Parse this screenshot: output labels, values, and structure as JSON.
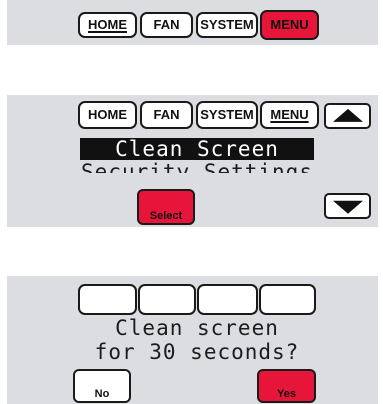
{
  "panel_1": {
    "tabs": [
      {
        "label": "HOME"
      },
      {
        "label": "FAN"
      },
      {
        "label": "SYSTEM"
      },
      {
        "label": "MENU"
      }
    ]
  },
  "panel_2": {
    "tabs": [
      {
        "label": "HOME"
      },
      {
        "label": "FAN"
      },
      {
        "label": "SYSTEM"
      },
      {
        "label": "MENU"
      }
    ],
    "selected_item": "Clean Screen",
    "next_item": "Security Settings",
    "select_label": "Select"
  },
  "panel_3": {
    "message_line1": "Clean screen",
    "message_line2": "for 30 seconds?",
    "no_label": "No",
    "yes_label": "Yes"
  },
  "colors": {
    "panel_bg": "#dcdde0",
    "accent_red": "#e8153b",
    "highlight_bg": "#111111"
  },
  "icons": [
    "arrow-up-icon",
    "arrow-down-icon"
  ]
}
